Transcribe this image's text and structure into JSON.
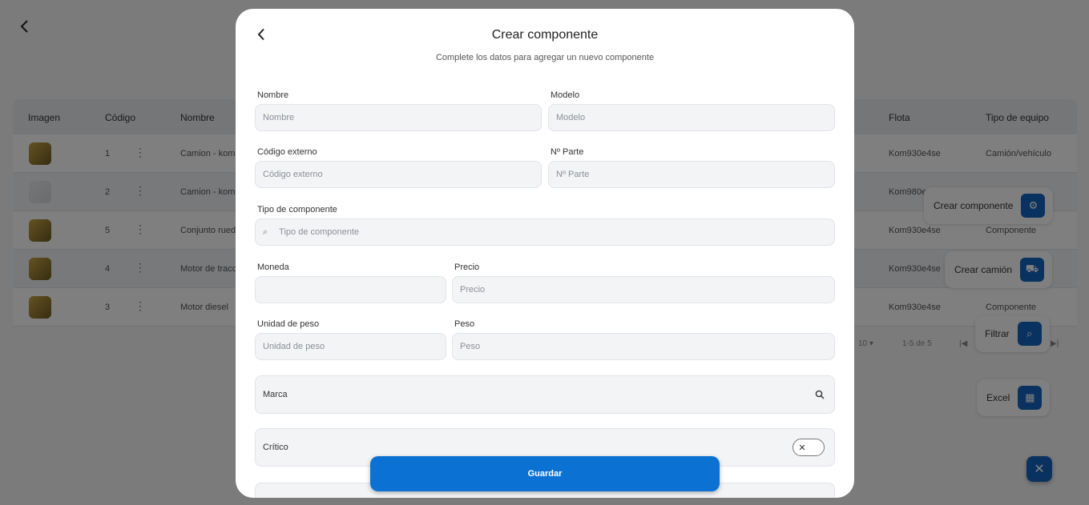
{
  "background": {
    "table_headers": [
      "Imagen",
      "Código",
      "Nombre",
      "Flota",
      "Tipo de equipo"
    ],
    "rows": [
      {
        "codigo": "1",
        "nombre": "Camion - koma",
        "flota": "Kom930e4se",
        "tipo": "Camión/vehículo"
      },
      {
        "codigo": "2",
        "nombre": "Camion - koma",
        "flota": "Kom980e",
        "tipo": ""
      },
      {
        "codigo": "5",
        "nombre": "Conjunto rueda",
        "flota": "Kom930e4se",
        "tipo": "Componente"
      },
      {
        "codigo": "4",
        "nombre": "Motor de tracc",
        "flota": "Kom930e4se",
        "tipo": ""
      },
      {
        "codigo": "3",
        "nombre": "Motor diesel",
        "flota": "Kom930e4se",
        "tipo": "Componente"
      }
    ],
    "pager": {
      "per_page": "10",
      "range": "1-5 de 5"
    },
    "fab_actions": [
      {
        "label": "Crear componente",
        "icon": "component-icon"
      },
      {
        "label": "Crear camión",
        "icon": "truck-icon"
      },
      {
        "label": "Filtrar",
        "icon": "search-icon"
      },
      {
        "label": "Excel",
        "icon": "excel-icon"
      }
    ]
  },
  "modal": {
    "title": "Crear componente",
    "subtitle": "Complete los datos para agregar un nuevo componente",
    "fields": {
      "nombre": {
        "label": "Nombre",
        "placeholder": "Nombre"
      },
      "modelo": {
        "label": "Modelo",
        "placeholder": "Modelo"
      },
      "codigo_externo": {
        "label": "Código externo",
        "placeholder": "Código externo"
      },
      "n_parte": {
        "label": "Nº Parte",
        "placeholder": "Nº Parte"
      },
      "tipo_componente": {
        "label": "Tipo de componente",
        "placeholder": "Tipo de componente"
      },
      "moneda": {
        "label": "Moneda",
        "placeholder": ""
      },
      "precio": {
        "label": "Precio",
        "placeholder": "Precio"
      },
      "unidad_peso": {
        "label": "Unidad de peso",
        "placeholder": "Unidad de peso"
      },
      "peso": {
        "label": "Peso",
        "placeholder": "Peso"
      }
    },
    "marca": "Marca",
    "critico": "Crítico",
    "save_label": "Guardar"
  },
  "colors": {
    "primary": "#0b72d4",
    "fab": "#1565c0"
  }
}
